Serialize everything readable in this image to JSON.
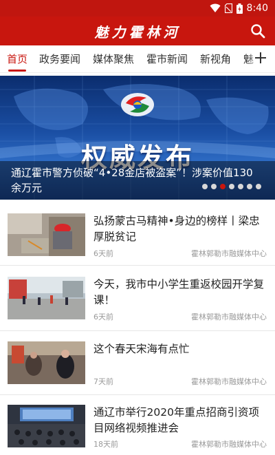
{
  "status_bar": {
    "time": "8:40"
  },
  "app_bar": {
    "title": "魅力霍林河"
  },
  "tabs": [
    {
      "label": "首页",
      "active": true
    },
    {
      "label": "政务要闻",
      "active": false
    },
    {
      "label": "媒体聚焦",
      "active": false
    },
    {
      "label": "霍市新闻",
      "active": false
    },
    {
      "label": "新视角",
      "active": false
    },
    {
      "label": "魅",
      "active": false
    }
  ],
  "banner": {
    "image_text": "权威发布",
    "caption": "通辽霍市警方侦破“4•28金店被盗案”！涉案价值130余万元",
    "slide_count": 7,
    "active_slide": 3
  },
  "news": [
    {
      "title": "弘扬蒙古马精神•身边的榜样丨梁忠厚脱贫记",
      "time": "6天前",
      "source": "霍林郭勒市融媒体中心"
    },
    {
      "title": "今天，我市中小学生重返校园开学复课！",
      "time": "6天前",
      "source": "霍林郭勒市融媒体中心"
    },
    {
      "title": "这个春天宋海有点忙",
      "time": "7天前",
      "source": "霍林郭勒市融媒体中心"
    },
    {
      "title": "通辽市举行2020年重点招商引资项目网络视频推进会",
      "time": "18天前",
      "source": "霍林郭勒市融媒体中心"
    }
  ],
  "colors": {
    "brand_red": "#c8160e",
    "indicator_inactive": "#d8d8d8"
  }
}
